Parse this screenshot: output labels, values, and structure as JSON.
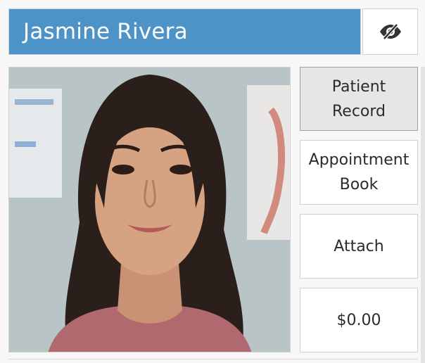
{
  "patient": {
    "name": "Jasmine Rivera"
  },
  "photo": {
    "alt": "Patient photo"
  },
  "actions": {
    "patient_record": [
      "Patient",
      "Record"
    ],
    "appointment_book": [
      "Appointment",
      "Book"
    ],
    "attach": "Attach",
    "balance": "$0.00"
  },
  "icons": {
    "privacy_toggle": "eye-slash-icon"
  },
  "colors": {
    "name_bar": "#4d93c8",
    "active_button": "#e6e6e6"
  }
}
